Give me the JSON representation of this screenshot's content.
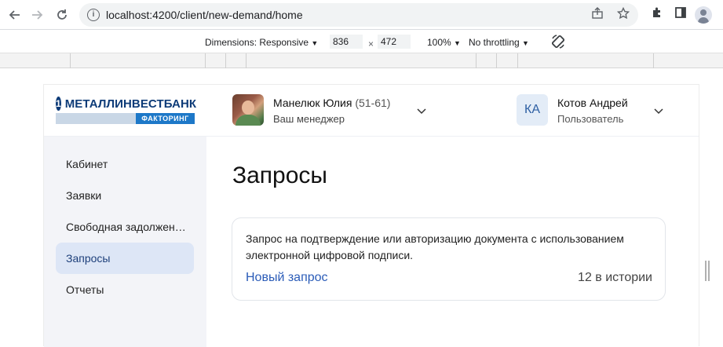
{
  "browser": {
    "url": "localhost:4200/client/new-demand/home"
  },
  "devtools": {
    "dimensions_label": "Dimensions: Responsive",
    "width_value": "836",
    "height_value": "472",
    "times": "×",
    "zoom": "100%",
    "throttling": "No throttling"
  },
  "header": {
    "logo_name": "МЕТАЛЛИНВЕСТБАНК",
    "logo_mark": "1",
    "logo_sub": "ФАКТОРИНГ",
    "manager_name": "Манелюк Юлия",
    "manager_ext": "(51-61)",
    "manager_role": "Ваш менеджер",
    "user_initials": "КА",
    "user_name": "Котов Андрей",
    "user_role": "Пользователь"
  },
  "sidebar": {
    "items": [
      {
        "label": "Кабинет",
        "active": false
      },
      {
        "label": "Заявки",
        "active": false
      },
      {
        "label": "Свободная задолжен…",
        "active": false
      },
      {
        "label": "Запросы",
        "active": true
      },
      {
        "label": "Отчеты",
        "active": false
      }
    ]
  },
  "main": {
    "title": "Запросы",
    "card": {
      "description": "Запрос на подтверждение или авторизацию документа с использованием электронной цифровой подписи.",
      "link": "Новый запрос",
      "count": "12 в истории"
    }
  },
  "colors": {
    "accent": "#2b5cb8",
    "sidebar_active": "#dde6f6",
    "brand": "#0d3b78"
  }
}
